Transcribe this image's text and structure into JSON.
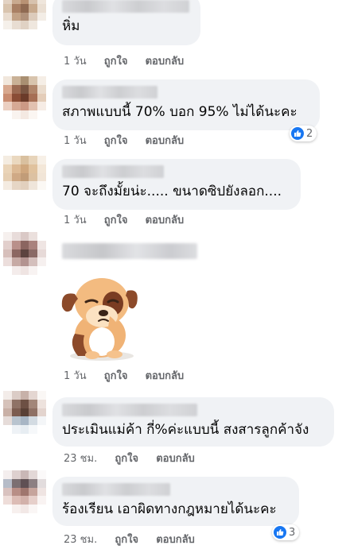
{
  "comments": [
    {
      "text": "หิ่ม",
      "time": "1 วัน",
      "like": "ถูกใจ",
      "reply": "ตอบกลับ"
    },
    {
      "text": "สภาพแบบนี้ 70% บอก 95% ไม่ได้นะคะ",
      "time": "1 วัน",
      "like": "ถูกใจ",
      "reply": "ตอบกลับ",
      "reaction_count": "2"
    },
    {
      "text": "70 จะถึงมั้ยน่ะ..... ขนาดซิปยังลอก....",
      "time": "1 วัน",
      "like": "ถูกใจ",
      "reply": "ตอบกลับ"
    },
    {
      "sticker": "sad-puppy-sticker",
      "time": "1 วัน",
      "like": "ถูกใจ",
      "reply": "ตอบกลับ"
    },
    {
      "text": "ประเมินแม่ค้า กี่%ค่ะแบบนี้  สงสารลูกค้าจัง",
      "time": "23 ชม.",
      "like": "ถูกใจ",
      "reply": "ตอบกลับ"
    },
    {
      "text": "ร้องเรียน เอาผิดทางกฎหมายได้นะคะ",
      "time": "23 ชม.",
      "like": "ถูกใจ",
      "reply": "ตอบกลับ",
      "reaction_count": "3"
    }
  ],
  "colors": {
    "bubble": "#f0f2f5",
    "meta_text": "#65676b",
    "like_blue": "#1877f2"
  },
  "icons": [
    "like-icon"
  ]
}
